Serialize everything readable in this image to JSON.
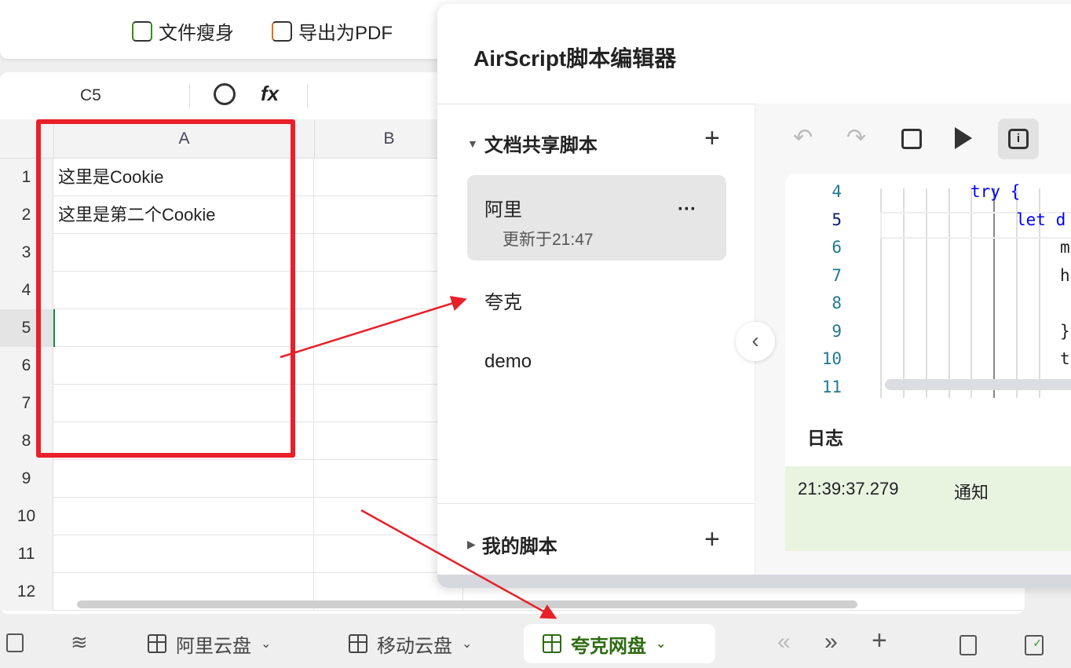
{
  "toolbar": {
    "slim_label": "文件瘦身",
    "pdf_label": "导出为PDF"
  },
  "formula_bar": {
    "cell_ref": "C5",
    "fx_label": "fx"
  },
  "sheet": {
    "columns": [
      "A",
      "B"
    ],
    "rows": [
      {
        "n": "1",
        "a": "这里是Cookie"
      },
      {
        "n": "2",
        "a": "这里是第二个Cookie"
      },
      {
        "n": "3",
        "a": ""
      },
      {
        "n": "4",
        "a": ""
      },
      {
        "n": "5",
        "a": ""
      },
      {
        "n": "6",
        "a": ""
      },
      {
        "n": "7",
        "a": ""
      },
      {
        "n": "8",
        "a": ""
      },
      {
        "n": "9",
        "a": ""
      },
      {
        "n": "10",
        "a": ""
      },
      {
        "n": "11",
        "a": ""
      },
      {
        "n": "12",
        "a": ""
      }
    ]
  },
  "tabs": [
    {
      "label": "阿里云盘"
    },
    {
      "label": "移动云盘"
    },
    {
      "label": "夸克网盘",
      "active": true
    }
  ],
  "editor": {
    "title": "AirScript脚本编辑器",
    "shared_section": "文档共享脚本",
    "my_section": "我的脚本",
    "scripts": [
      {
        "name": "阿里",
        "updated": "更新于21:47",
        "more": "···"
      },
      {
        "name": "夸克"
      },
      {
        "name": "demo"
      }
    ],
    "code_lines": [
      {
        "n": "4",
        "text": "try {"
      },
      {
        "n": "5",
        "text": "let d"
      },
      {
        "n": "6",
        "text": "m"
      },
      {
        "n": "7",
        "text": "h"
      },
      {
        "n": "8",
        "text": ""
      },
      {
        "n": "9",
        "text": "}"
      },
      {
        "n": "10",
        "text": "t"
      },
      {
        "n": "11",
        "text": ""
      }
    ],
    "log_title": "日志",
    "log_entries": [
      {
        "time": "21:39:37.279",
        "level": "通知"
      }
    ]
  },
  "colors": {
    "accent_green": "#2e6b12",
    "annotation_red": "#e8202a"
  }
}
